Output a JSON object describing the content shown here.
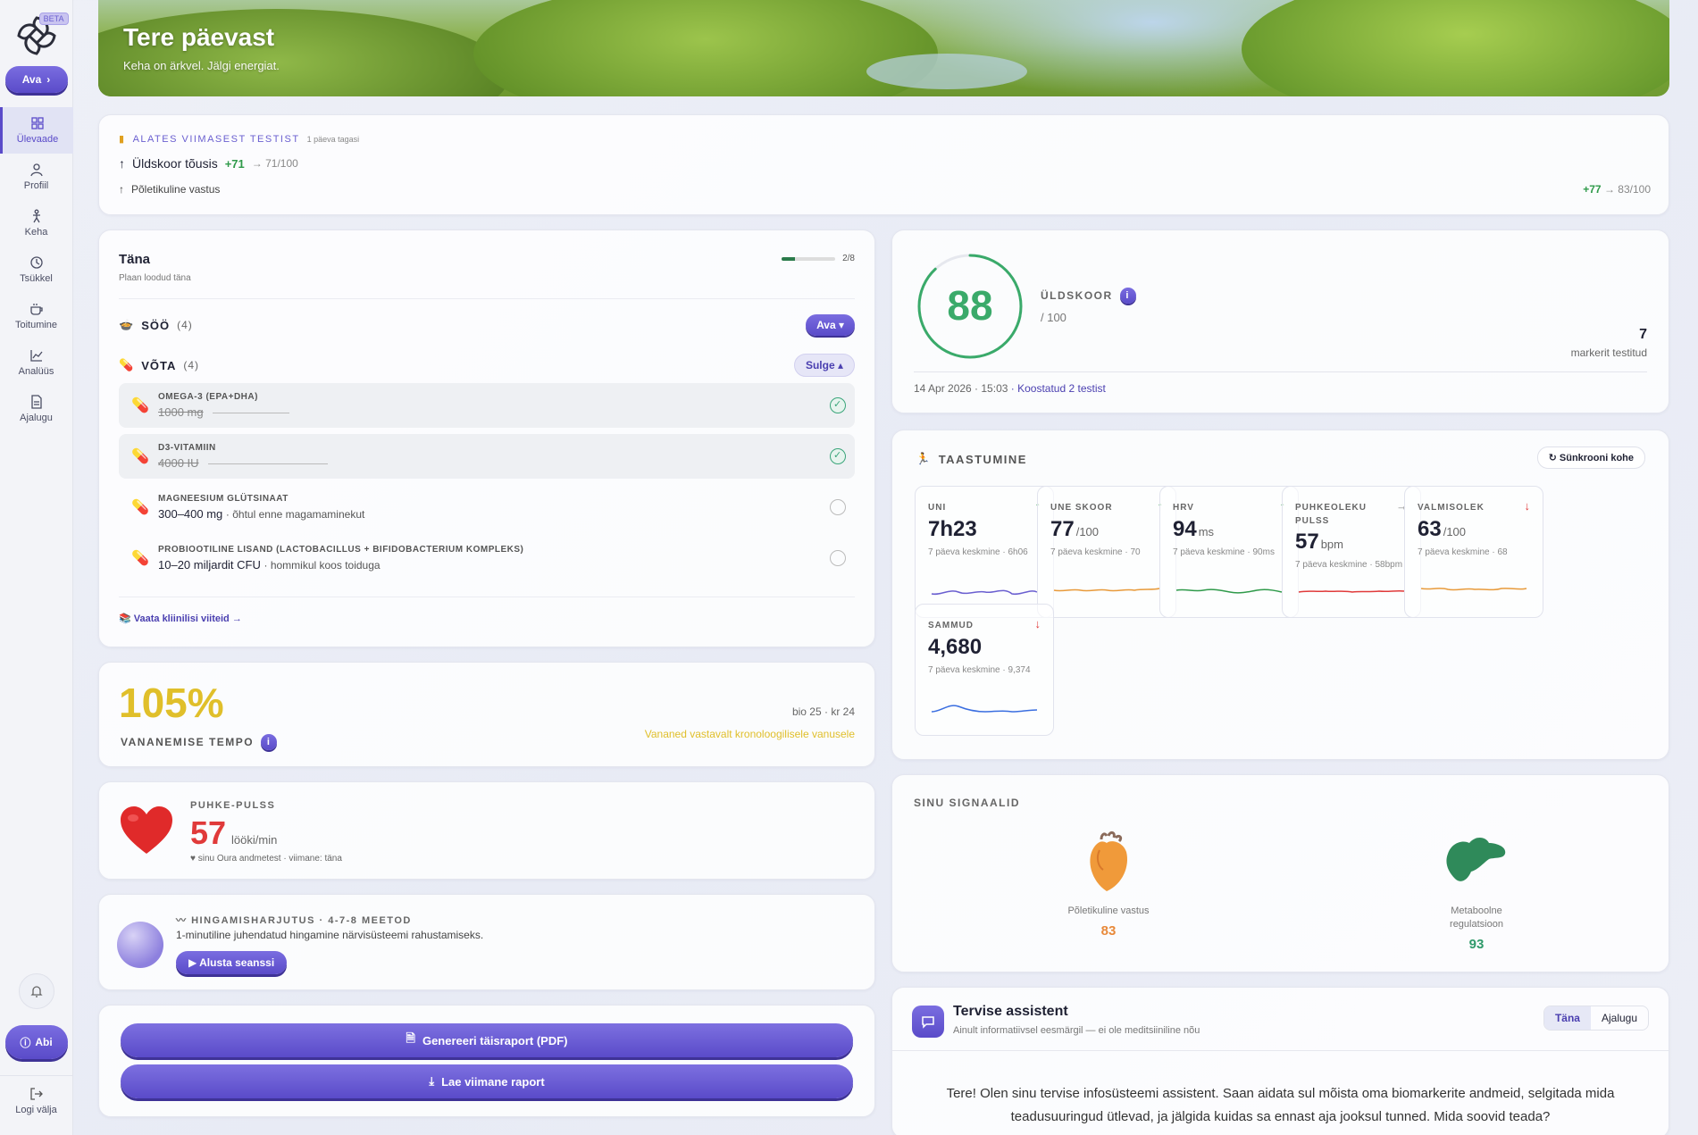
{
  "sidebar": {
    "beta": "BETA",
    "ava": "Ava",
    "items": [
      {
        "label": "Ülevaade"
      },
      {
        "label": "Profiil"
      },
      {
        "label": "Keha"
      },
      {
        "label": "Tsükkel"
      },
      {
        "label": "Toitumine"
      },
      {
        "label": "Analüüs"
      },
      {
        "label": "Ajalugu"
      }
    ],
    "abi": "Abi",
    "logout": "Logi välja"
  },
  "hero": {
    "title": "Tere päevast",
    "subtitle": "Keha on ärkvel. Jälgi energiat."
  },
  "since": {
    "heading": "ALATES VIIMASEST TESTIST",
    "ago": "1 päeva tagasi",
    "row1_label": "Üldskoor tõusis",
    "row1_delta": "+71",
    "row1_to": "→ 71/100",
    "row2_label": "Põletikuline vastus",
    "row2_delta": "+77",
    "row2_to": "→ 83/100"
  },
  "today": {
    "title": "Täna",
    "subtitle": "Plaan loodud täna",
    "progress_text": "2/8",
    "progress_fraction": 0.25,
    "eat_label": "SÖÖ",
    "eat_count": "(4)",
    "eat_btn": "Ava ▾",
    "take_label": "VÕTA",
    "take_count": "(4)",
    "take_btn": "Sulge ▴",
    "supplements": [
      {
        "name": "OMEGA-3 (EPA+DHA)",
        "dose": "1000 mg",
        "note": "",
        "done": true
      },
      {
        "name": "D3-VITAMIIN",
        "dose": "4000 IU",
        "note": "",
        "done": true
      },
      {
        "name": "MAGNEESIUM GLÜTSINAAT",
        "dose": "300–400 mg",
        "note": "· õhtul enne magamaminekut",
        "done": false
      },
      {
        "name": "PROBIOOTILINE LISAND (LACTOBACILLUS + BIFIDOBACTERIUM KOMPLEKS)",
        "dose": "10–20 miljardit CFU",
        "note": "· hommikul koos toiduga",
        "done": false
      }
    ],
    "link": "Vaata kliinilisi viiteid →"
  },
  "tempo": {
    "value": "105%",
    "label": "VANANEMISE TEMPO",
    "ages": "bio 25 · kr 24",
    "desc": "Vananed vastavalt kronoloogilisele vanusele"
  },
  "pulse": {
    "label": "PUHKE-PULSS",
    "value": "57",
    "unit": "lööki/min",
    "source": "♥ sinu Oura andmetest · viimane: täna"
  },
  "breath": {
    "label": "HINGAMISHARJUTUS · 4-7-8 MEETOD",
    "desc": "1-minutiline juhendatud hingamine närvisüsteemi rahustamiseks.",
    "button": "▶ Alusta seanssi"
  },
  "reports": {
    "generate": "Genereeri täisraport (PDF)",
    "download": "Lae viimane raport"
  },
  "score": {
    "value": "88",
    "value_num": 88,
    "label": "ÜLDSKOOR",
    "max": "/ 100",
    "markers": "7",
    "markers_label": "markerit testitud",
    "date": "14 Apr 2026 · 15:03",
    "compiled": "· Koostatud 2 testist"
  },
  "recovery": {
    "label": "TAASTUMINE",
    "sync": "↻ Sünkrooni kohe",
    "metrics": [
      {
        "name": "UNI",
        "value": "7h23",
        "unit": "",
        "avg": "7 päeva keskmine · 6h06",
        "arrow": "↑",
        "arrow_color": "#2f9a4a",
        "line_color": "#6a5fd0"
      },
      {
        "name": "UNE SKOOR",
        "value": "77",
        "unit": "/100",
        "avg": "7 päeva keskmine · 70",
        "arrow": "↑",
        "arrow_color": "#2f9a4a",
        "line_color": "#e89a3a"
      },
      {
        "name": "HRV",
        "value": "94",
        "unit": "ms",
        "avg": "7 päeva keskmine · 90ms",
        "arrow": "↑",
        "arrow_color": "#2f9a4a",
        "line_color": "#2f9a4a"
      },
      {
        "name": "PUHKEOLEKU PULSS",
        "value": "57",
        "unit": "bpm",
        "avg": "7 päeva keskmine · 58bpm",
        "arrow": "→",
        "arrow_color": "#888888",
        "line_color": "#e03a3a"
      },
      {
        "name": "VALMISOLEK",
        "value": "63",
        "unit": "/100",
        "avg": "7 päeva keskmine · 68",
        "arrow": "↓",
        "arrow_color": "#e03a3a",
        "line_color": "#e89a3a"
      },
      {
        "name": "SAMMUD",
        "value": "4,680",
        "unit": "",
        "avg": "7 päeva keskmine · 9,374",
        "arrow": "↓",
        "arrow_color": "#e03a3a",
        "line_color": "#3a6ee0"
      }
    ]
  },
  "signals": {
    "label": "SINU SIGNAALID",
    "items": [
      {
        "name": "Põletikuline vastus",
        "score": "83",
        "color": "#e8893a",
        "icon": "heart-organ-icon"
      },
      {
        "name": "Metaboolne regulatsioon",
        "score": "93",
        "color": "#2f9a6a",
        "icon": "pancreas-icon"
      }
    ]
  },
  "assistant": {
    "title": "Tervise assistent",
    "subtitle": "Ainult informatiivsel eesmärgil — ei ole meditsiiniline nõu",
    "tab_today": "Täna",
    "tab_history": "Ajalugu",
    "message": "Tere! Olen sinu tervise infosüsteemi assistent. Saan aidata sul mõista oma biomarkerite andmeid, selgitada mida teadusuuringud ütlevad, ja jälgida kuidas sa ennast aja jooksul tunned. Mida soovid teada?"
  }
}
